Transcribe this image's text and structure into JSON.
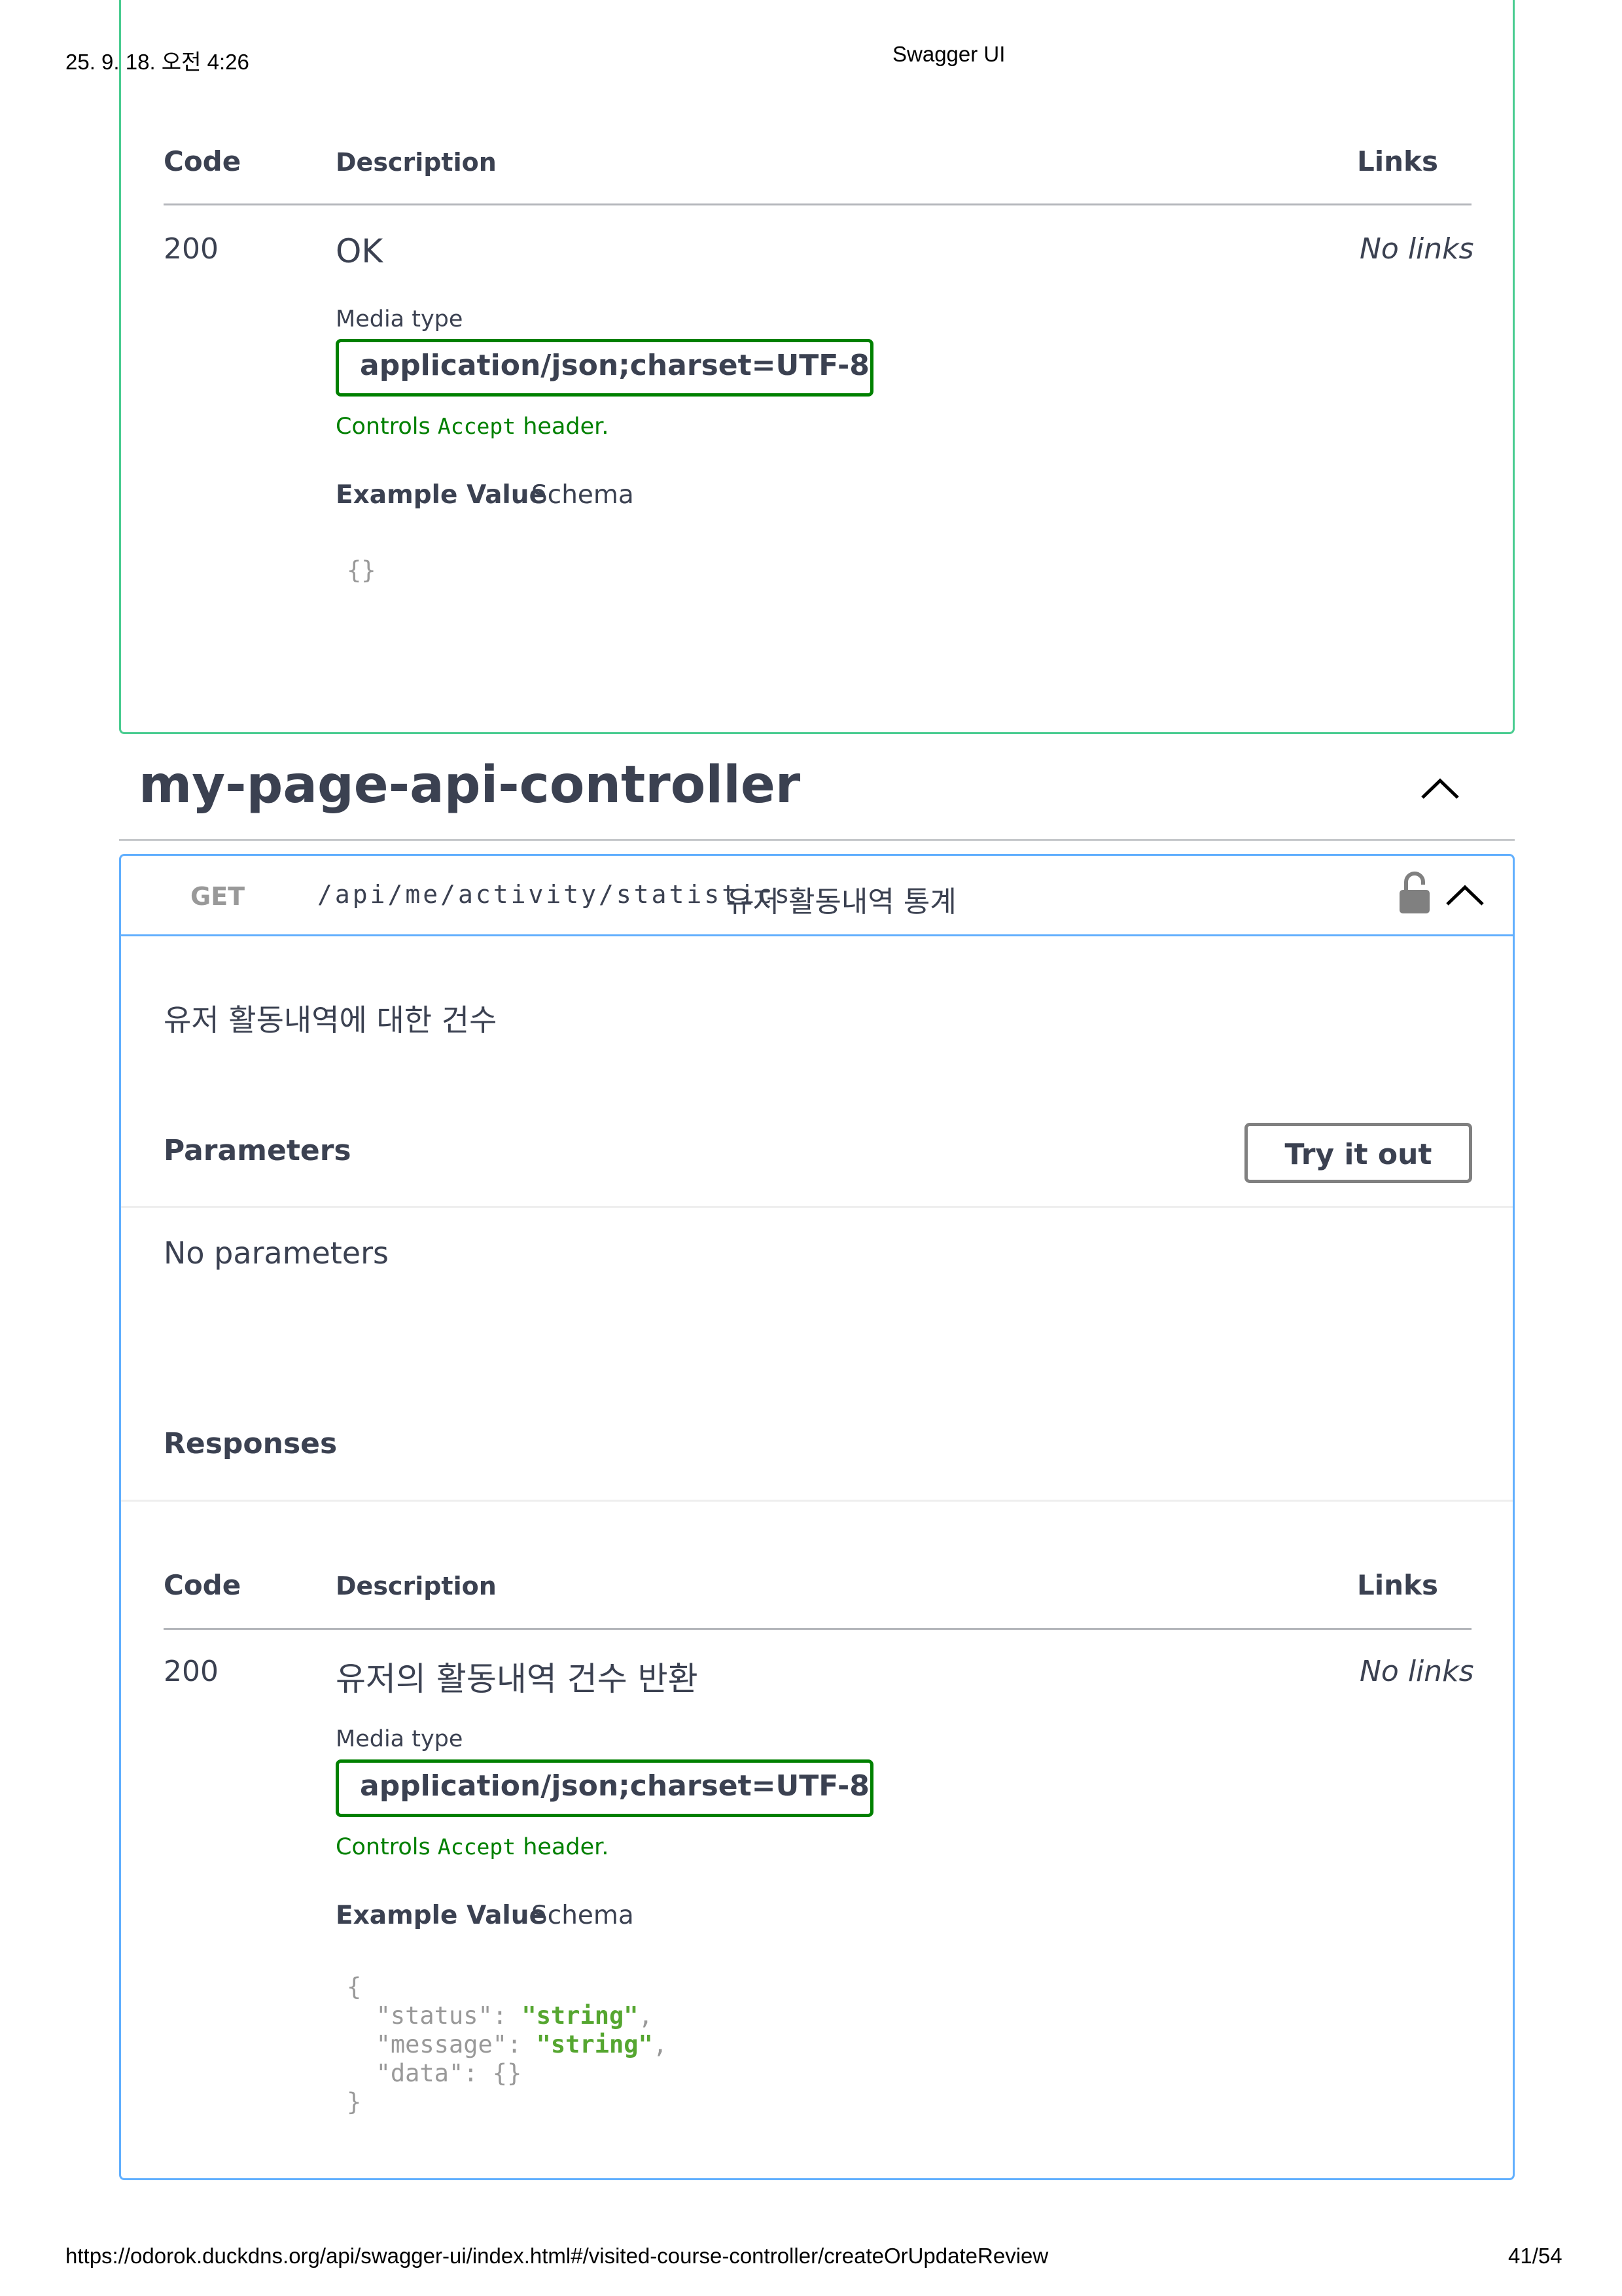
{
  "print_header": {
    "datetime": "25. 9. 18. 오전 4:26",
    "title": "Swagger UI"
  },
  "print_footer": {
    "url": "https://odorok.duckdns.org/api/swagger-ui/index.html#/visited-course-controller/createOrUpdateReview",
    "page": "41/54"
  },
  "colors": {
    "green_border": "#49cc90",
    "blue_border": "#61affe",
    "media_border": "#008000",
    "text": "#3b4151"
  },
  "prev_operation": {
    "responses_table": {
      "code_header": "Code",
      "description_header": "Description",
      "links_header": "Links",
      "row": {
        "code": "200",
        "description": "OK",
        "links": "No links",
        "media_type_label": "Media type",
        "media_type": "application/json;charset=UTF-8",
        "controls_prefix": "Controls ",
        "controls_code": "Accept",
        "controls_suffix": " header.",
        "example_tab": "Example Value",
        "schema_tab": "Schema",
        "example": "{}"
      }
    }
  },
  "section": {
    "title": "my-page-api-controller",
    "toggle_icon": "chevron-up-icon"
  },
  "operation": {
    "method": "GET",
    "path": "/api/me/activity/statistics",
    "summary": "유저 활동내역 통계",
    "lock_icon": "unlock-icon",
    "toggle_icon": "chevron-up-icon",
    "description": "유저 활동내역에 대한 건수",
    "parameters_label": "Parameters",
    "try_it_out": "Try it out",
    "no_parameters": "No parameters",
    "responses_label": "Responses",
    "responses_table": {
      "code_header": "Code",
      "description_header": "Description",
      "links_header": "Links",
      "row": {
        "code": "200",
        "description": "유저의 활동내역 건수 반환",
        "links": "No links",
        "media_type_label": "Media type",
        "media_type": "application/json;charset=UTF-8",
        "controls_prefix": "Controls ",
        "controls_code": "Accept",
        "controls_suffix": " header.",
        "example_tab": "Example Value",
        "schema_tab": "Schema",
        "example_lines": {
          "open": "{",
          "status_key": "\"status\"",
          "status_val": "\"string\"",
          "message_key": "\"message\"",
          "message_val": "\"string\"",
          "data_key": "\"data\"",
          "data_val": "{}",
          "close": "}"
        }
      }
    }
  }
}
